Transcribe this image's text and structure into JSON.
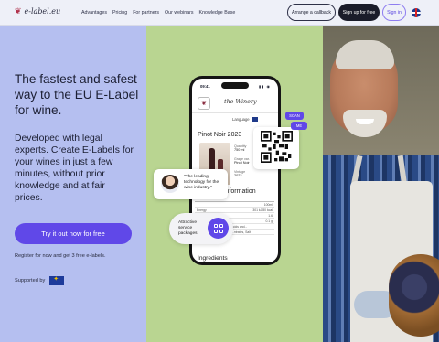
{
  "nav": {
    "logo_text": "e-label.eu",
    "links": [
      "Advantages",
      "Pricing",
      "For partners",
      "Our webinars",
      "Knowledge Base"
    ],
    "callback_label": "Arrange a callback",
    "signup_label": "Sign up for free",
    "signin_label": "Sign in",
    "language_flag": "uk-flag-icon"
  },
  "hero": {
    "headline": "The fastest and safest way to the EU E-Label for wine.",
    "subtext": "Developed with legal experts. Create E-Labels for your wines in just a few minutes, without prior knowledge and at fair prices.",
    "cta_label": "Try it out now for free",
    "register_note": "Register for now and get 3 free e-labels.",
    "supported_by": "Supported by",
    "supported_logo": "eu-flag-icon"
  },
  "phone": {
    "time": "09:41",
    "winery": "the Winery",
    "language_label": "Language",
    "wine_name": "Pinot Noir 2023",
    "specs": [
      {
        "label": "Quantity",
        "value": "750 ml"
      },
      {
        "label": "Grape var.",
        "value": "Pinot Noir"
      },
      {
        "label": "Vintage",
        "value": "2023"
      }
    ],
    "info_heading": "information",
    "table_rows": [
      {
        "label": "",
        "value": "100ml"
      },
      {
        "label": "Energy",
        "value": "301 kJ/80 kcal"
      },
      {
        "label": "",
        "value": "1.6"
      },
      {
        "label": "",
        "value": "0.1 g"
      },
      {
        "label": "",
        "value": "acids and..."
      },
      {
        "label": "",
        "value": "...ntrates, Salt"
      }
    ],
    "ingredients_heading": "Ingredients"
  },
  "overlays": {
    "scan_label": "SCAN",
    "me_label": "ME",
    "quote": "\"The leading technology for the wine industry.\"",
    "service": "Attractive service packages",
    "accent": "#6048e8"
  },
  "colors": {
    "left_panel": "#b5bff0",
    "middle_panel": "#b9d591",
    "cta": "#6048e8",
    "signup_bg": "#1a1c2a"
  }
}
